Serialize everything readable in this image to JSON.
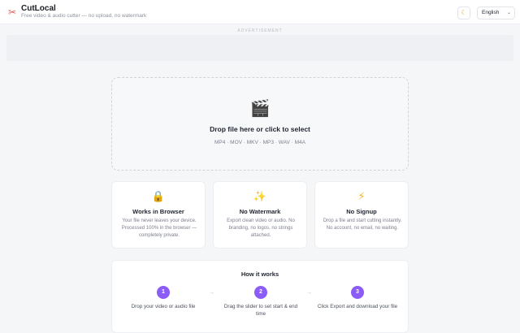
{
  "header": {
    "logo_icon": "scissors-icon",
    "title": "CutLocal",
    "tagline": "Free video & audio cutter — no upload, no watermark",
    "theme_icon": "moon-icon",
    "language": "English"
  },
  "ad": {
    "label": "ADVERTISEMENT"
  },
  "dropzone": {
    "icon": "clapperboard-icon",
    "title": "Drop file here or click to select",
    "formats": "MP4 · MOV · MKV · MP3 · WAV · M4A"
  },
  "features": [
    {
      "icon": "lock-icon",
      "title": "Works in Browser",
      "description": "Your file never leaves your device. Processed 100% in the browser — completely private."
    },
    {
      "icon": "sparkles-icon",
      "title": "No Watermark",
      "description": "Export clean video or audio. No branding, no logos, no strings attached."
    },
    {
      "icon": "lightning-icon",
      "title": "No Signup",
      "description": "Drop a file and start cutting instantly. No account, no email, no waiting."
    }
  ],
  "how_it_works": {
    "title": "How it works",
    "steps": [
      {
        "number": "1",
        "label": "Drop your video or audio file"
      },
      {
        "number": "2",
        "label": "Drag the slider to set start & end time"
      },
      {
        "number": "3",
        "label": "Click Export and download your file"
      }
    ]
  },
  "colors": {
    "accent": "#8b5cf6",
    "background": "#f5f6f8",
    "card": "#ffffff"
  }
}
